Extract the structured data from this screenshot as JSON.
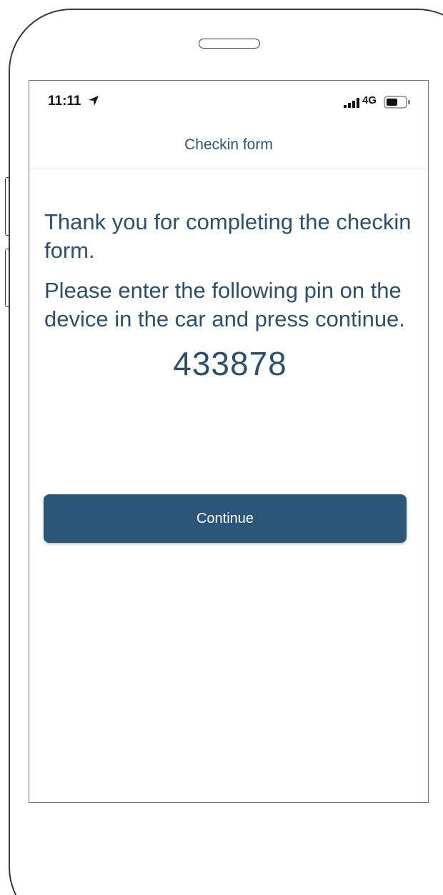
{
  "status_bar": {
    "time": "11:11",
    "network": "4G",
    "location_icon": "location-arrow-icon",
    "signal_icon": "signal-bars-icon",
    "battery_icon": "battery-icon"
  },
  "nav": {
    "title": "Checkin form"
  },
  "content": {
    "thanks": "Thank you for completing the checkin form.",
    "instruction": "Please enter the following pin on the device in the car and press continue.",
    "pin": "433878"
  },
  "actions": {
    "continue_label": "Continue"
  },
  "colors": {
    "accent": "#2c5677",
    "text": "#2b4f72"
  }
}
